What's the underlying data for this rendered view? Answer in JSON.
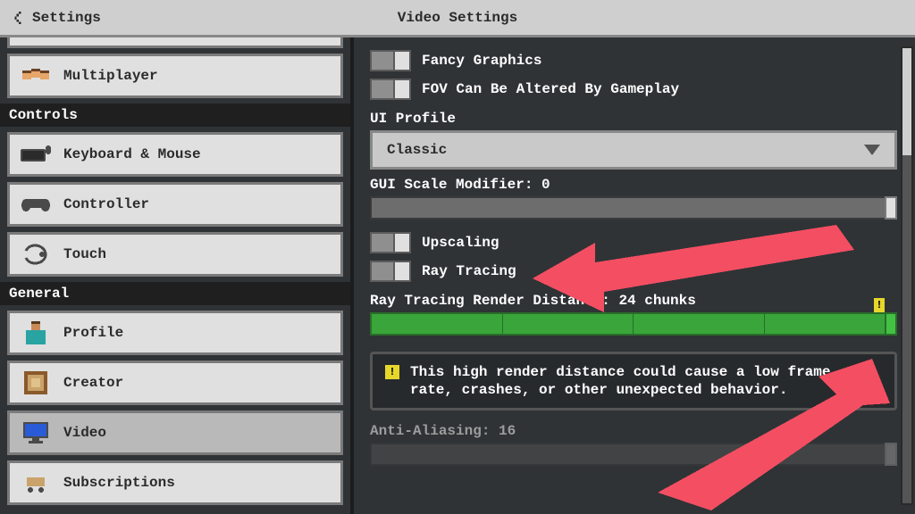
{
  "header": {
    "back_label": "Settings",
    "title": "Video Settings"
  },
  "sidebar": {
    "sections": [
      {
        "header": null,
        "items": [
          {
            "id": "multiplayer",
            "label": "Multiplayer"
          }
        ]
      },
      {
        "header": "Controls",
        "items": [
          {
            "id": "keyboard-mouse",
            "label": "Keyboard & Mouse"
          },
          {
            "id": "controller",
            "label": "Controller"
          },
          {
            "id": "touch",
            "label": "Touch"
          }
        ]
      },
      {
        "header": "General",
        "items": [
          {
            "id": "profile",
            "label": "Profile"
          },
          {
            "id": "creator",
            "label": "Creator"
          },
          {
            "id": "video",
            "label": "Video",
            "selected": true
          },
          {
            "id": "subscriptions",
            "label": "Subscriptions"
          }
        ]
      }
    ]
  },
  "video": {
    "fancy_graphics": {
      "label": "Fancy Graphics",
      "on": false
    },
    "fov_gameplay": {
      "label": "FOV Can Be Altered By Gameplay",
      "on": false
    },
    "ui_profile": {
      "label": "UI Profile",
      "value": "Classic"
    },
    "gui_scale": {
      "label": "GUI Scale Modifier: 0",
      "value": 0,
      "pct": 100
    },
    "upscaling": {
      "label": "Upscaling",
      "on": false
    },
    "ray_tracing": {
      "label": "Ray Tracing",
      "on": false
    },
    "rt_distance": {
      "label": "Ray Tracing Render Distance: 24 chunks",
      "value": 24,
      "pct": 100
    },
    "warning": "This high render distance could cause a low frame rate, crashes, or other unexpected behavior.",
    "anti_aliasing": {
      "label": "Anti-Aliasing: 16",
      "value": 16,
      "pct": 100,
      "disabled": true
    }
  },
  "icons": {
    "multiplayer": "players-icon",
    "keyboard-mouse": "keyboard-icon",
    "controller": "gamepad-icon",
    "touch": "hand-icon",
    "profile": "steve-icon",
    "creator": "frame-icon",
    "video": "monitor-icon",
    "subscriptions": "cart-icon"
  },
  "annotations": {
    "arrow_to_upscaling": true,
    "arrow_to_rt_handle": true,
    "color": "#f44e62"
  }
}
